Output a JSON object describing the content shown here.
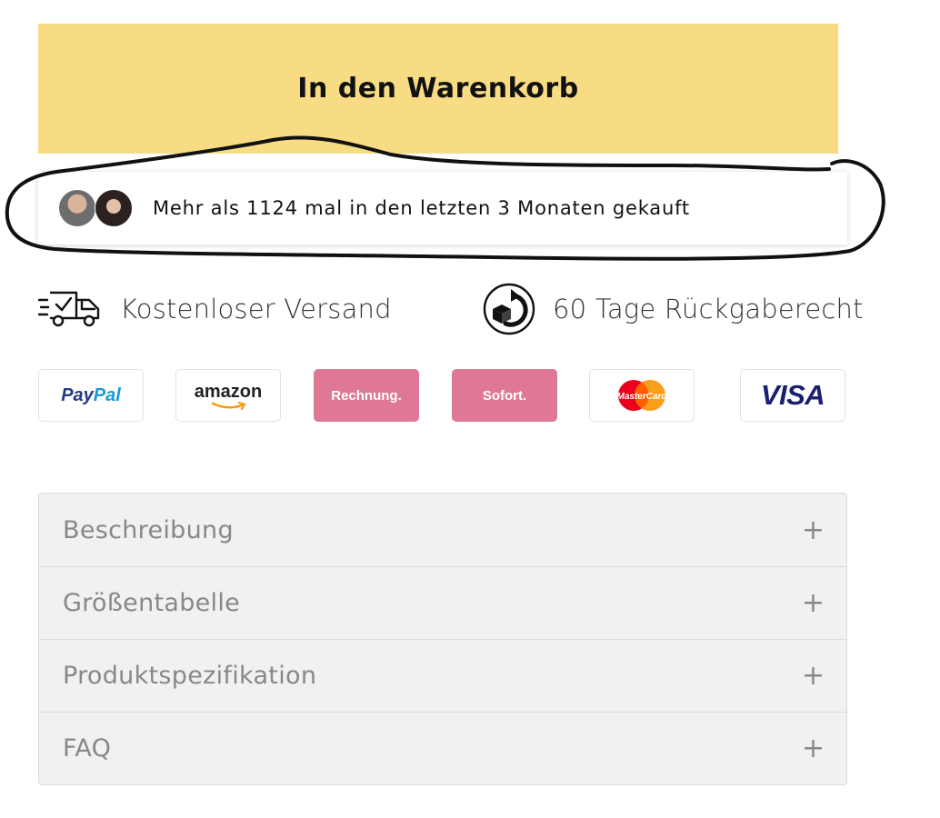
{
  "cart": {
    "button_label": "In den Warenkorb"
  },
  "social_proof": {
    "text": "Mehr als 1124 mal in den letzten 3 Monaten gekauft"
  },
  "benefits": [
    {
      "icon": "delivery-truck-icon",
      "label": "Kostenloser Versand"
    },
    {
      "icon": "return-box-icon",
      "label": "60 Tage Rückgaberecht"
    }
  ],
  "payment_methods": {
    "paypal": {
      "part1": "Pay",
      "part2": "Pal"
    },
    "amazon": "amazon",
    "rechnung": "Rechnung.",
    "sofort": "Sofort.",
    "mastercard": "MasterCard",
    "visa": "VISA"
  },
  "accordion": [
    {
      "label": "Beschreibung",
      "toggle": "+"
    },
    {
      "label": "Größentabelle",
      "toggle": "+"
    },
    {
      "label": "Produktspezifikation",
      "toggle": "+"
    },
    {
      "label": "FAQ",
      "toggle": "+"
    }
  ],
  "colors": {
    "cart_button": "#f7dc84",
    "payment_pink": "#df7894",
    "accordion_bg": "#f1f1f1"
  }
}
